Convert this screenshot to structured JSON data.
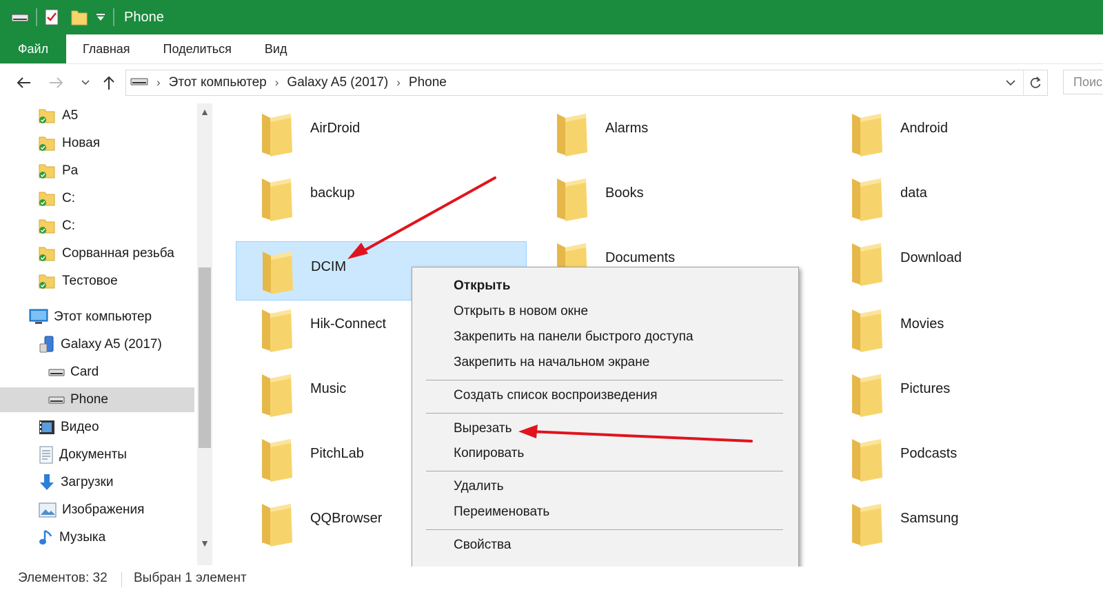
{
  "window": {
    "title": "Phone",
    "accent": "#1b8b3e"
  },
  "ribbon": {
    "tabs": [
      "Файл",
      "Главная",
      "Поделиться",
      "Вид"
    ]
  },
  "address": {
    "crumbs": [
      "Этот компьютер",
      "Galaxy A5 (2017)",
      "Phone"
    ],
    "search_placeholder": "Поис"
  },
  "nav": {
    "quick_access": [
      "A5",
      "Новая",
      "Pa",
      "C:",
      "C:",
      "Сорванная резьба",
      "Тестовое"
    ],
    "this_pc": "Этот компьютер",
    "device": "Galaxy A5 (2017)",
    "storage": [
      "Card",
      "Phone"
    ],
    "libraries": [
      "Видео",
      "Документы",
      "Загрузки",
      "Изображения",
      "Музыка"
    ]
  },
  "folders": [
    [
      "AirDroid",
      "Alarms",
      "Android"
    ],
    [
      "backup",
      "Books",
      "data"
    ],
    [
      "DCIM",
      "Documents",
      "Download"
    ],
    [
      "Hik-Connect",
      "",
      "Movies"
    ],
    [
      "Music",
      "",
      "Pictures"
    ],
    [
      "PitchLab",
      "",
      "Podcasts"
    ],
    [
      "QQBrowser",
      "",
      "Samsung"
    ]
  ],
  "selected_folder": "DCIM",
  "context_menu": {
    "items": [
      "Открыть",
      "Открыть в новом окне",
      "Закрепить на панели быстрого доступа",
      "Закрепить на начальном экране",
      "Создать список воспроизведения",
      "Вырезать",
      "Копировать",
      "Удалить",
      "Переименовать",
      "Свойства"
    ]
  },
  "status": {
    "count": "Элементов: 32",
    "selection": "Выбран 1 элемент"
  },
  "annotation_color": "#e0141e"
}
